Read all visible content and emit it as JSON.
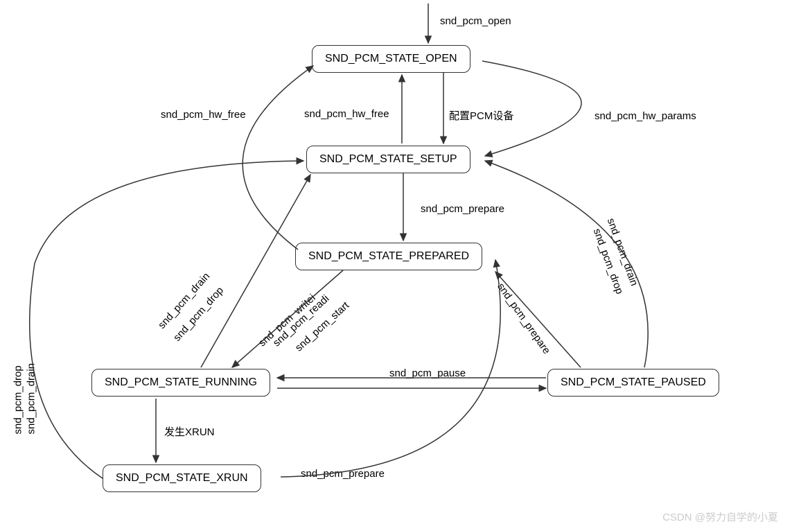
{
  "nodes": {
    "open": "SND_PCM_STATE_OPEN",
    "setup": "SND_PCM_STATE_SETUP",
    "prepared": "SND_PCM_STATE_PREPARED",
    "running": "SND_PCM_STATE_RUNNING",
    "paused": "SND_PCM_STATE_PAUSED",
    "xrun": "SND_PCM_STATE_XRUN"
  },
  "labels": {
    "snd_pcm_open": "snd_pcm_open",
    "snd_pcm_hw_free_left": "snd_pcm_hw_free",
    "snd_pcm_hw_free_mid": "snd_pcm_hw_free",
    "config_pcm": "配置PCM设备",
    "snd_pcm_hw_params": "snd_pcm_hw_params",
    "snd_pcm_prepare_mid": "snd_pcm_prepare",
    "snd_pcm_drain_left": "snd_pcm_drain",
    "snd_pcm_drop_left": "snd_pcm_drop",
    "snd_pcm_writei": "snd_pcm_writei",
    "snd_pcm_readi": "snd_pcm_readi",
    "snd_pcm_start": "snd_pcm_start",
    "snd_pcm_prepare_paused": "snd_pcm_prepare",
    "snd_pcm_drain_right": "snd_pcm_drain",
    "snd_pcm_drop_right": "snd_pcm_drop",
    "snd_pcm_pause": "snd_pcm_pause",
    "xrun_event": "发生XRUN",
    "snd_pcm_prepare_xrun": "snd_pcm_prepare",
    "snd_pcm_drop_far": "snd_pcm_drop",
    "snd_pcm_drain_far": "snd_pcm_drain"
  },
  "watermark": "CSDN @努力自学的小夏"
}
